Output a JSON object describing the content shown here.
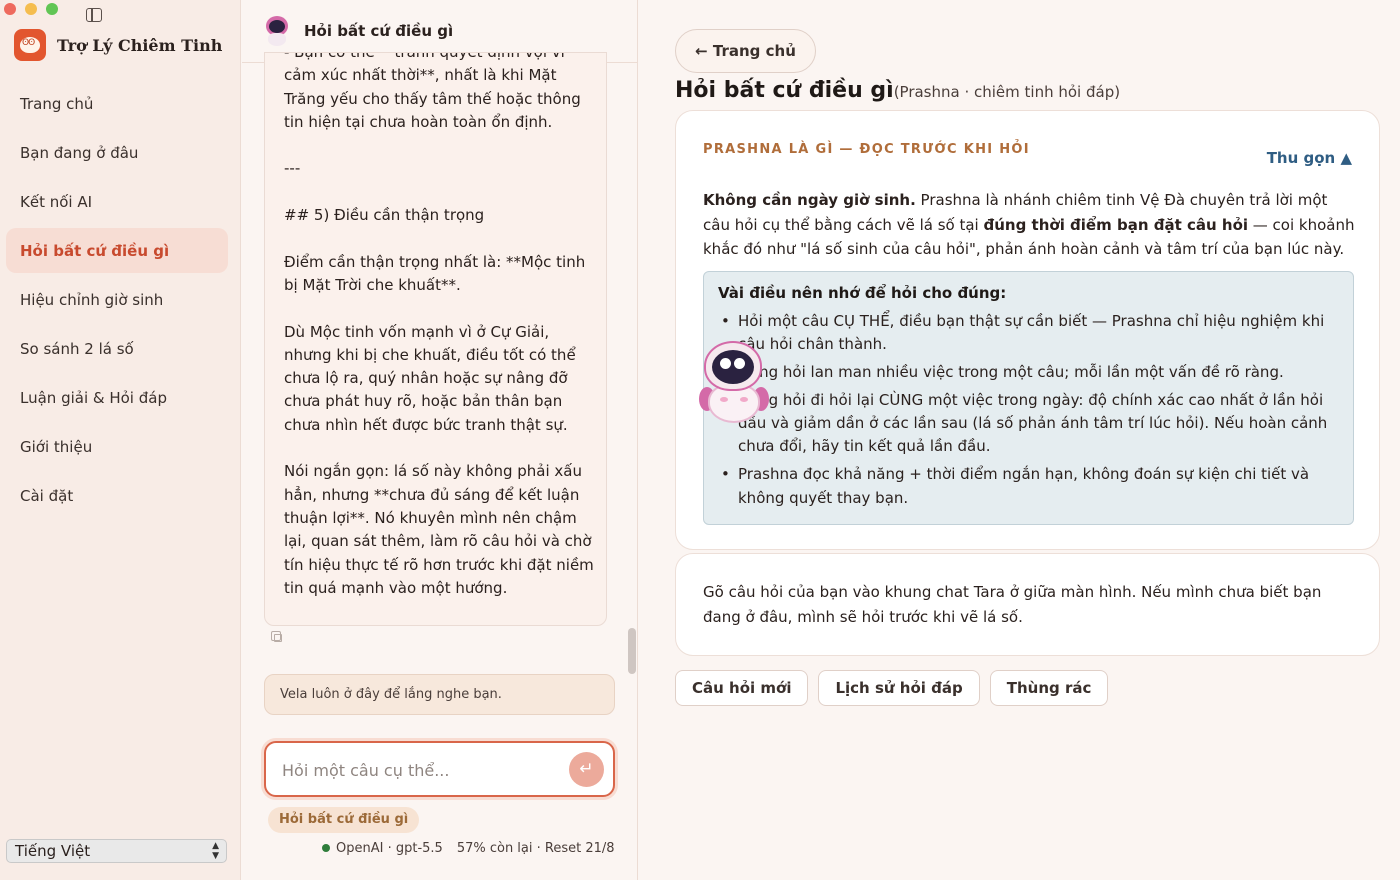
{
  "sidebar": {
    "app_name": "Trợ Lý Chiêm Tinh",
    "items": [
      {
        "label": "Trang chủ"
      },
      {
        "label": "Bạn đang ở đâu"
      },
      {
        "label": "Kết nối AI"
      },
      {
        "label": "Hỏi bất cứ điều gì",
        "active": true
      },
      {
        "label": "Hiệu chỉnh giờ sinh"
      },
      {
        "label": "So sánh 2 lá số"
      },
      {
        "label": "Luận giải & Hỏi đáp"
      },
      {
        "label": "Giới thiệu"
      },
      {
        "label": "Cài đặt"
      }
    ],
    "language": "Tiếng Việt"
  },
  "chat": {
    "title": "Hỏi bất cứ điều gì",
    "message": "- Bạn có thể **tránh quyết định vội vì cảm xúc nhất thời**, nhất là khi Mặt Trăng yếu cho thấy tâm thế hoặc thông tin hiện tại chưa hoàn toàn ổn định.\n\n---\n\n## 5) Điều cần thận trọng\n\nĐiểm cần thận trọng nhất là: **Mộc tinh bị Mặt Trời che khuất**.\n\nDù Mộc tinh vốn mạnh vì ở Cự Giải, nhưng khi bị che khuất, điều tốt có thể chưa lộ ra, quý nhân hoặc sự nâng đỡ chưa phát huy rõ, hoặc bản thân bạn chưa nhìn hết được bức tranh thật sự.\n\nNói ngắn gọn: lá số này không phải xấu hẳn, nhưng **chưa đủ sáng để kết luận thuận lợi**. Nó khuyên mình nên chậm lại, quan sát thêm, làm rõ câu hỏi và chờ tín hiệu thực tế rõ hơn trước khi đặt niềm tin quá mạnh vào một hướng.",
    "status_note": "Vela luôn ở đây để lắng nghe bạn.",
    "input_placeholder": "Hỏi một câu cụ thể...",
    "input_value": "",
    "mode_tag": "Hỏi bất cứ điều gì",
    "model": "OpenAI · gpt-5.5",
    "quota": "57% còn lại · Reset 21/8"
  },
  "main": {
    "back_label": "← Trang chủ",
    "title": "Hỏi bất cứ điều gì",
    "subtitle": "(Prashna · chiêm tinh hỏi đáp)",
    "card_label": "PRASHNA LÀ GÌ — ĐỌC TRƯỚC KHI HỎI",
    "collapse_label": "Thu gọn ▲",
    "intro": {
      "bold1": "Không cần ngày giờ sinh.",
      "text1": " Prashna là nhánh chiêm tinh Vệ Đà chuyên trả lời một câu hỏi cụ thể bằng cách vẽ lá số tại ",
      "bold2": "đúng thời điểm bạn đặt câu hỏi",
      "text2": " — coi khoảnh khắc đó như \"lá số sinh của câu hỏi\", phản ánh hoàn cảnh và tâm trí của bạn lúc này."
    },
    "tips_title": "Vài điều nên nhớ để hỏi cho đúng:",
    "tips": [
      "Hỏi một câu CỤ THỂ, điều bạn thật sự cần biết — Prashna chỉ hiệu nghiệm khi câu hỏi chân thành.",
      "Đừng hỏi lan man nhiều việc trong một câu; mỗi lần một vấn đề rõ ràng.",
      "Đừng hỏi đi hỏi lại CÙNG một việc trong ngày: độ chính xác cao nhất ở lần hỏi đầu và giảm dần ở các lần sau (lá số phản ánh tâm trí lúc hỏi). Nếu hoàn cảnh chưa đổi, hãy tin kết quả lần đầu.",
      "Prashna đọc khả năng + thời điểm ngắn hạn, không đoán sự kiện chi tiết và không quyết thay bạn."
    ],
    "hint": "Gõ câu hỏi của bạn vào khung chat Tara ở giữa màn hình. Nếu mình chưa biết bạn đang ở đâu, mình sẽ hỏi trước khi vẽ lá số.",
    "actions": [
      "Câu hỏi mới",
      "Lịch sử hỏi đáp",
      "Thùng rác"
    ]
  }
}
